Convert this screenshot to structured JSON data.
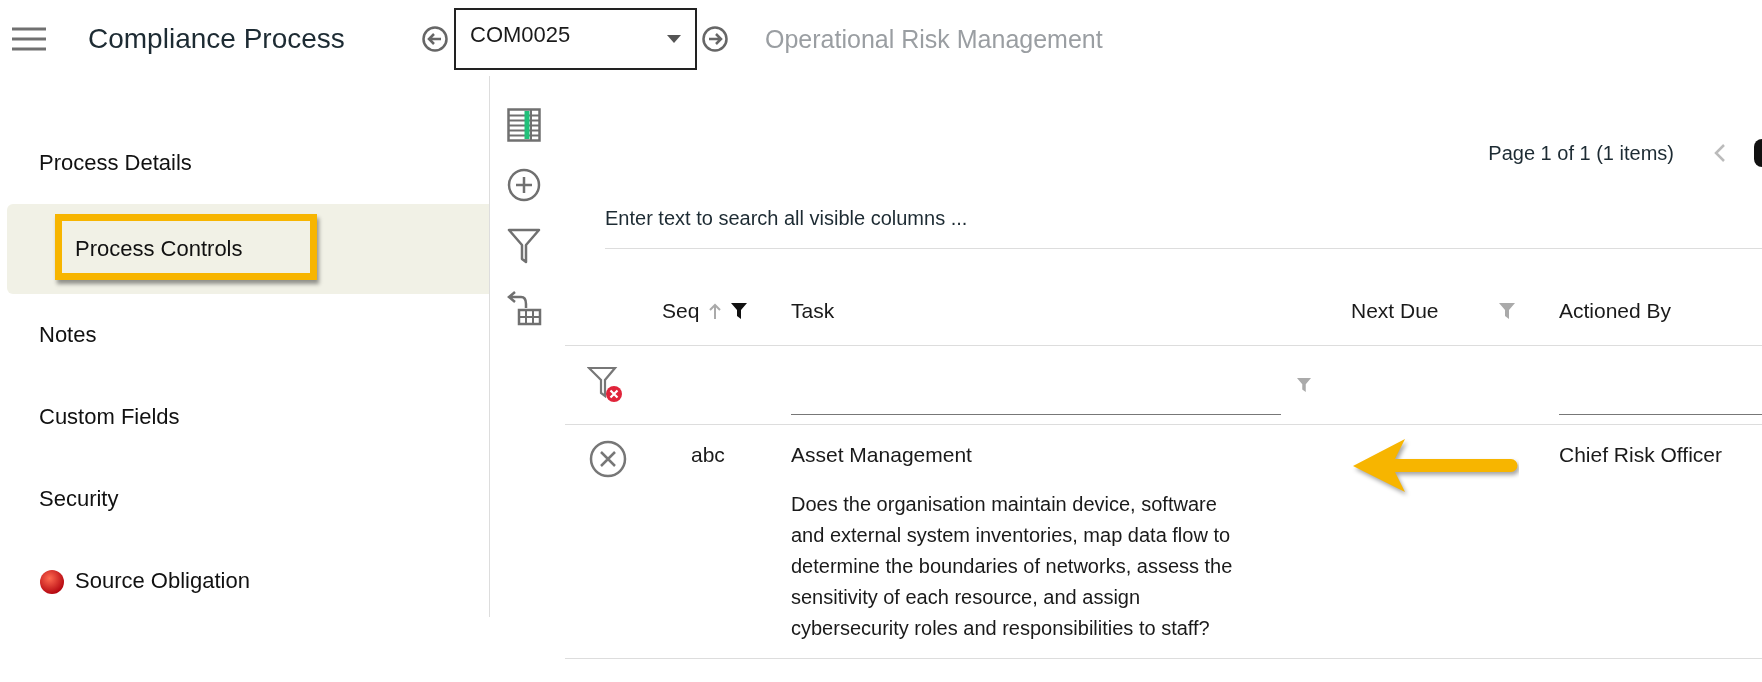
{
  "header": {
    "title": "Compliance Process",
    "record_select": {
      "value": "COM0025"
    },
    "subtitle": "Operational Risk Management"
  },
  "sidebar": {
    "items": [
      {
        "label": "Process Details",
        "selected": false,
        "highlighted": false,
        "kind": "text"
      },
      {
        "label": "Process Controls",
        "selected": true,
        "highlighted": true,
        "kind": "text"
      },
      {
        "label": "Notes",
        "selected": false,
        "highlighted": false,
        "kind": "text"
      },
      {
        "label": "Custom Fields",
        "selected": false,
        "highlighted": false,
        "kind": "text"
      },
      {
        "label": "Security",
        "selected": false,
        "highlighted": false,
        "kind": "text"
      },
      {
        "label": "Source Obligation",
        "selected": false,
        "highlighted": false,
        "kind": "icon"
      }
    ]
  },
  "pager": {
    "text": "Page 1 of 1 (1 items)"
  },
  "search": {
    "placeholder": "Enter text to search all visible columns ..."
  },
  "table": {
    "columns": [
      {
        "label": "Seq",
        "sorted_ascending": true,
        "header_filter": true,
        "filter_active": true,
        "filter_input": false,
        "filter_input_icon": false
      },
      {
        "label": "Task",
        "sorted_ascending": false,
        "header_filter": false,
        "filter_active": false,
        "filter_input": true,
        "filter_input_icon": true
      },
      {
        "label": "Next Due",
        "sorted_ascending": false,
        "header_filter": true,
        "filter_active": false,
        "filter_input": false,
        "filter_input_icon": false
      },
      {
        "label": "Actioned By",
        "sorted_ascending": false,
        "header_filter": false,
        "filter_active": false,
        "filter_input": true,
        "filter_input_icon": false
      }
    ],
    "rows": [
      {
        "seq": "abc",
        "task": "Asset Management",
        "description": "Does the organisation maintain device, software and external system inventories, map data flow to determine the boundaries of networks, assess the sensitivity of each resource, and assign cybersecurity roles and responsibilities to staff?",
        "actioned_by": "Chief Risk Officer",
        "annotated": true
      }
    ]
  }
}
